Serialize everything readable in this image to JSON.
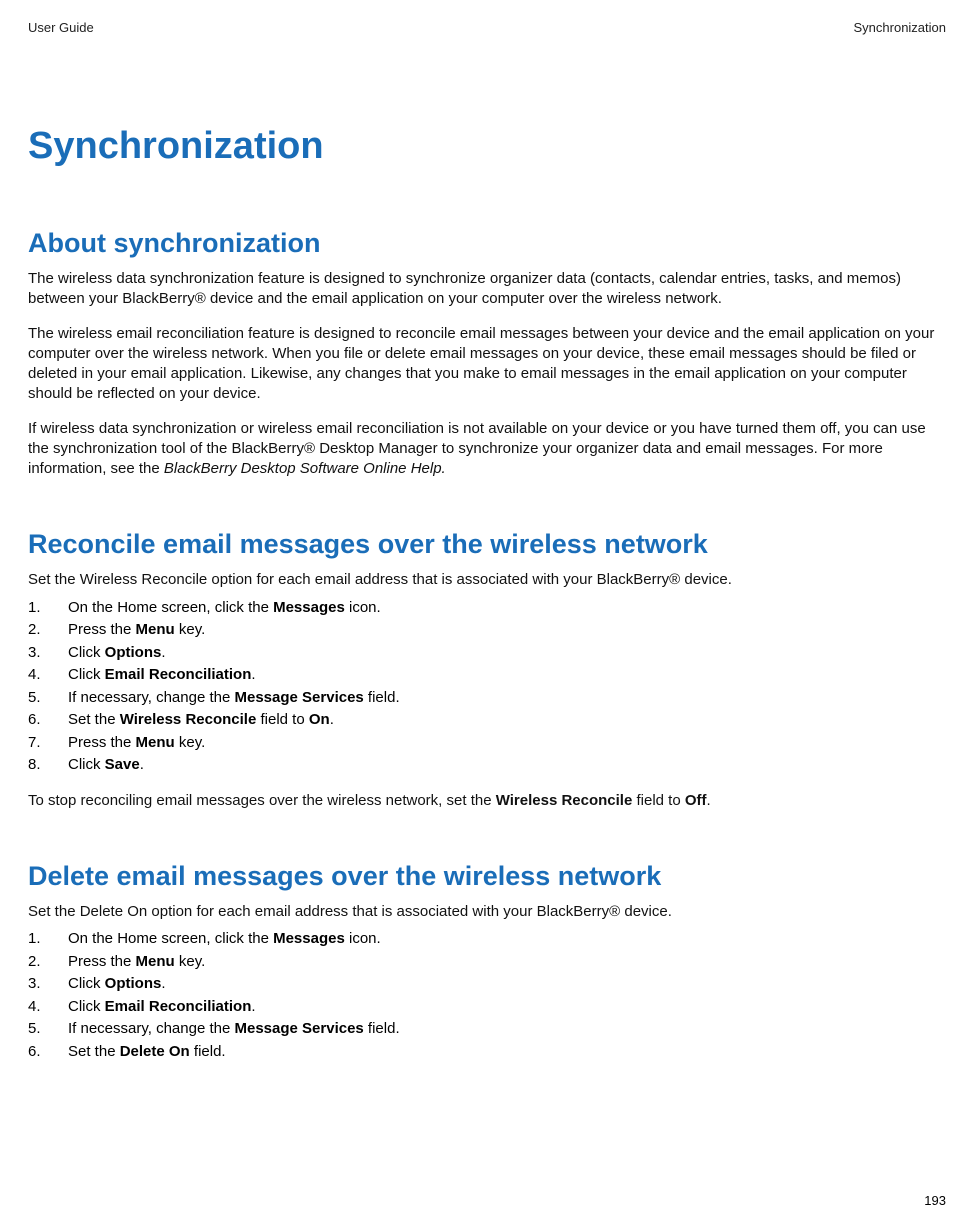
{
  "header": {
    "left": "User Guide",
    "right": "Synchronization"
  },
  "title": "Synchronization",
  "sections": {
    "about": {
      "heading": "About synchronization",
      "p1": "The wireless data synchronization feature is designed to synchronize organizer data (contacts, calendar entries, tasks, and memos) between your BlackBerry® device and the email application on your computer over the wireless network.",
      "p2": "The wireless email reconciliation feature is designed to reconcile email messages between your device and the email application on your computer over the wireless network. When you file or delete email messages on your device, these email messages should be filed or deleted in your email application. Likewise, any changes that you make to email messages in the email application on your computer should be reflected on your device.",
      "p3_pre": "If wireless data synchronization or wireless email reconciliation is not available on your device or you have turned them off, you can use the synchronization tool of the BlackBerry® Desktop Manager to synchronize your organizer data and email messages. For more information, see the  ",
      "p3_ital": "BlackBerry Desktop Software Online Help."
    },
    "reconcile": {
      "heading": "Reconcile email messages over the wireless network",
      "intro": "Set the Wireless Reconcile option for each email address that is associated with your BlackBerry® device.",
      "steps": {
        "s1_pre": "On the Home screen, click the ",
        "s1_b": "Messages",
        "s1_post": " icon.",
        "s2_pre": "Press the ",
        "s2_b": "Menu",
        "s2_post": " key.",
        "s3_pre": "Click ",
        "s3_b": "Options",
        "s3_post": ".",
        "s4_pre": "Click ",
        "s4_b": "Email Reconciliation",
        "s4_post": ".",
        "s5_pre": "If necessary, change the ",
        "s5_b": "Message Services",
        "s5_post": " field.",
        "s6_pre": "Set the ",
        "s6_b": "Wireless Reconcile",
        "s6_mid": " field to ",
        "s6_b2": "On",
        "s6_post": ".",
        "s7_pre": "Press the ",
        "s7_b": "Menu",
        "s7_post": " key.",
        "s8_pre": "Click ",
        "s8_b": "Save",
        "s8_post": "."
      },
      "outro_pre": "To stop reconciling email messages over the wireless network, set the ",
      "outro_b": "Wireless Reconcile",
      "outro_mid": " field to ",
      "outro_b2": "Off",
      "outro_post": "."
    },
    "delete": {
      "heading": "Delete email messages over the wireless network",
      "intro": "Set the Delete On option for each email address that is associated with your BlackBerry® device.",
      "steps": {
        "s1_pre": "On the Home screen, click the ",
        "s1_b": "Messages",
        "s1_post": " icon.",
        "s2_pre": "Press the ",
        "s2_b": "Menu",
        "s2_post": " key.",
        "s3_pre": "Click ",
        "s3_b": "Options",
        "s3_post": ".",
        "s4_pre": "Click ",
        "s4_b": "Email Reconciliation",
        "s4_post": ".",
        "s5_pre": "If necessary, change the ",
        "s5_b": "Message Services",
        "s5_post": " field.",
        "s6_pre": "Set the ",
        "s6_b": "Delete On",
        "s6_post": " field."
      }
    }
  },
  "pageNumber": "193"
}
